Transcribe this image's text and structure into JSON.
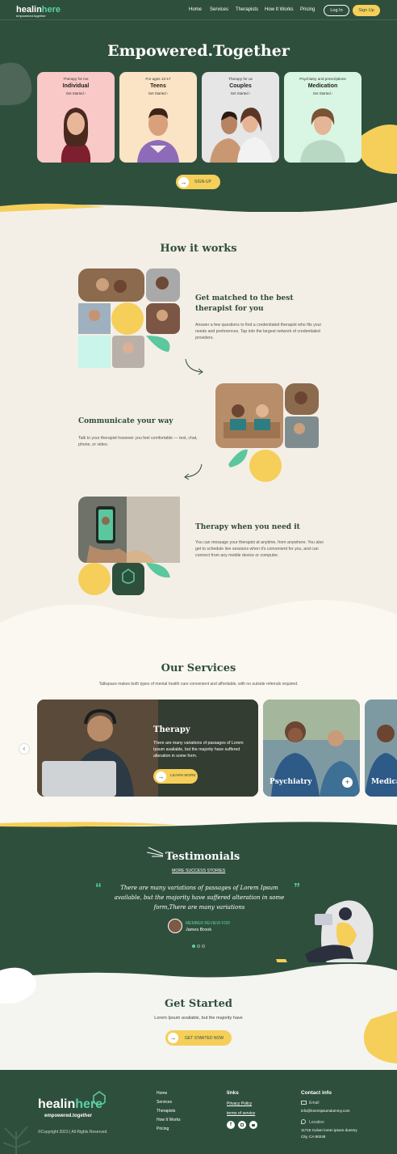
{
  "header": {
    "logo_main": "healin",
    "logo_accent": "here",
    "logo_tagline": "empowered.together",
    "nav": [
      "Home",
      "Services",
      "Therapists",
      "How It Works",
      "Pricing"
    ],
    "login": "Log In",
    "signup": "Sign Up"
  },
  "hero": {
    "title": "Empowered.Together",
    "cards": [
      {
        "small": "Therapy for me",
        "big": "Individual",
        "link": "Get Started ›",
        "bg": "#f8c9c6"
      },
      {
        "small": "For ages 13-17",
        "big": "Teens",
        "link": "Get Started ›",
        "bg": "#fbe3c6"
      },
      {
        "small": "Therapy for us",
        "big": "Couples",
        "link": "Get Started ›",
        "bg": "#e6e6e6"
      },
      {
        "small": "Psychiatry and prescriptions",
        "big": "Medication",
        "link": "Get Started ›",
        "bg": "#d9f5e3"
      }
    ],
    "cta": "SIGN-UP"
  },
  "how": {
    "title": "How it works",
    "steps": [
      {
        "heading": "Get matched to the best therapist for you",
        "text": "Answer a few questions to find a credentialed therapist who fits your needs and preferences. Tap into the largest network of credentialed providers."
      },
      {
        "heading": "Communicate your way",
        "text": "Talk to your therapist however you feel comfortable — text, chat, phone, or video."
      },
      {
        "heading": "Therapy when you need it",
        "text": "You can message your therapist at anytime, from anywhere. You also get to schedule live sessions when it's convenient for you, and can connect from any mobile device or computer."
      }
    ]
  },
  "services": {
    "title": "Our Services",
    "subtitle": "Talkspace makes both types of mental health care convenient and affordable, with no outside referrals required.",
    "main": {
      "title": "Therapy",
      "text": "There are many variations of passages of Lorem Ipsum available, but the majority have suffered alteration in some form.",
      "button": "LEARN MORE"
    },
    "second": "Psychiatry",
    "third": "Medica"
  },
  "testimonials": {
    "title": "Testimonials",
    "link": "MORE SUCCESS STORIES",
    "quote": "There are many variations of passages of Lorem Ipsum available, but the majority have suffered alteration in some form,There are many variations",
    "member_label": "MEMBER REVIEW FOR",
    "member_name": "James Brook"
  },
  "get_started": {
    "title": "Get Started",
    "text": "Lorem Ipsum available, but the majority have",
    "button": "GET STARTED NOW"
  },
  "footer": {
    "logo_main": "healin",
    "logo_accent": "here",
    "tagline": "empowered.together",
    "copyright": "©Copyright 2023 | All Rights Reserved.",
    "menu": [
      "Home",
      "Services",
      "Therapists",
      "How It Works",
      "Pricing"
    ],
    "links_title": "links",
    "links": [
      "Privacy Policy",
      "terms of service"
    ],
    "contact_title": "Contact info",
    "email_label": "Email",
    "email": "info@loremipsumdummy.com",
    "location_label": "Location",
    "address_1": "11715 Culver lorem ipsum dummy",
    "address_2": "City, CA 90248"
  },
  "colors": {
    "dark_green": "#2f4f3d",
    "yellow": "#f5cf5a",
    "mint": "#5ad0a6",
    "cream": "#f4efe6"
  }
}
